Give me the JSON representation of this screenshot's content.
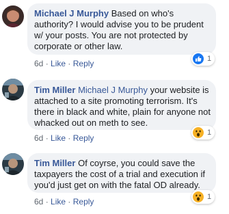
{
  "comments": [
    {
      "author": "Michael J Murphy",
      "mention": "",
      "text": "Based on who's authority? I would advise you to be prudent w/ your posts. You are not protected by corporate or other law.",
      "time": "6d",
      "like_label": "Like",
      "reply_label": "Reply",
      "reaction": {
        "type": "like",
        "count": "1",
        "color": "#1877f2"
      }
    },
    {
      "author": "Tim Miller",
      "mention": "Michael J Murphy",
      "text": "your website is attached to a site promoting terrorism. It's there in black and white, plain for anyone not whacked out on meth to see.",
      "time": "6d",
      "like_label": "Like",
      "reply_label": "Reply",
      "reaction": {
        "type": "wow",
        "count": "1",
        "color": "#f7b125"
      }
    },
    {
      "author": "Tim Miller",
      "mention": "",
      "text": "Of coyrse, you could save the taxpayers the cost of a trial and execution if you'd just get on with the fatal OD already.",
      "time": "6d",
      "like_label": "Like",
      "reply_label": "Reply",
      "reaction": {
        "type": "wow",
        "count": "1",
        "color": "#f7b125"
      }
    }
  ]
}
